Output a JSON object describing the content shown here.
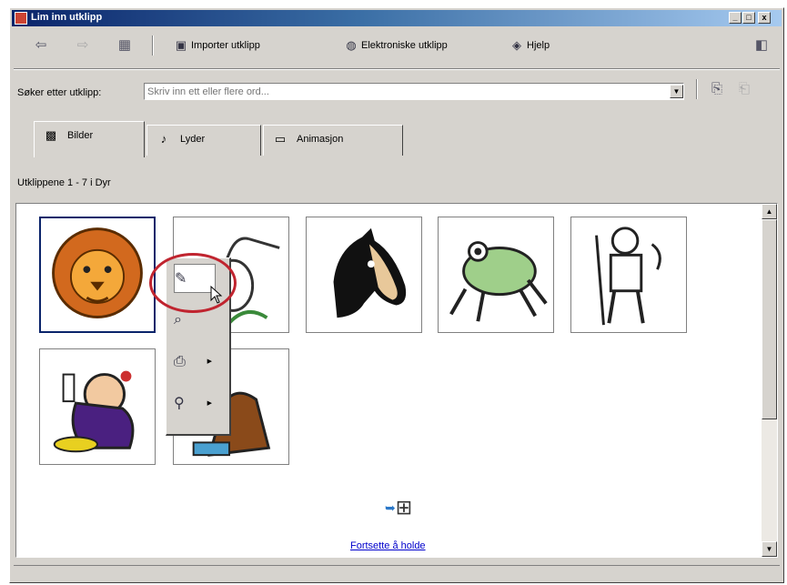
{
  "window": {
    "title": "Lim inn utklipp"
  },
  "title_buttons": {
    "minimize": "_",
    "maximize": "□",
    "close": "x"
  },
  "toolbar": {
    "import_label": "Importer utklipp",
    "online_label": "Elektroniske utklipp",
    "help_label": "Hjelp"
  },
  "search": {
    "label": "Søker etter utklipp:",
    "placeholder": "Skriv inn ett eller flere ord..."
  },
  "tabs": [
    {
      "label": "Bilder",
      "active": true,
      "icon": "pictures-icon"
    },
    {
      "label": "Lyder",
      "active": false,
      "icon": "sounds-icon"
    },
    {
      "label": "Animasjon",
      "active": false,
      "icon": "animation-icon"
    }
  ],
  "collection": {
    "label": "Utklippene 1 - 7 i Dyr"
  },
  "clips": [
    {
      "subject": "lion",
      "selected": true
    },
    {
      "subject": "heron",
      "selected": false
    },
    {
      "subject": "horse",
      "selected": false
    },
    {
      "subject": "frog",
      "selected": false
    },
    {
      "subject": "hunter",
      "selected": false
    },
    {
      "subject": "magician",
      "selected": false
    },
    {
      "subject": "dog",
      "selected": false
    }
  ],
  "keep_going": {
    "label": "Fortsette å holde"
  },
  "popup_menu": {
    "items": [
      "insert-clip-icon",
      "preview-clip-icon",
      "add-to-category-icon",
      "find-similar-icon"
    ],
    "highlighted": "insert-clip-icon"
  },
  "colors": {
    "titlebar": "#0a246a",
    "highlight_ring": "#c0242f",
    "link": "#0000cc",
    "face": "#d6d3ce"
  }
}
